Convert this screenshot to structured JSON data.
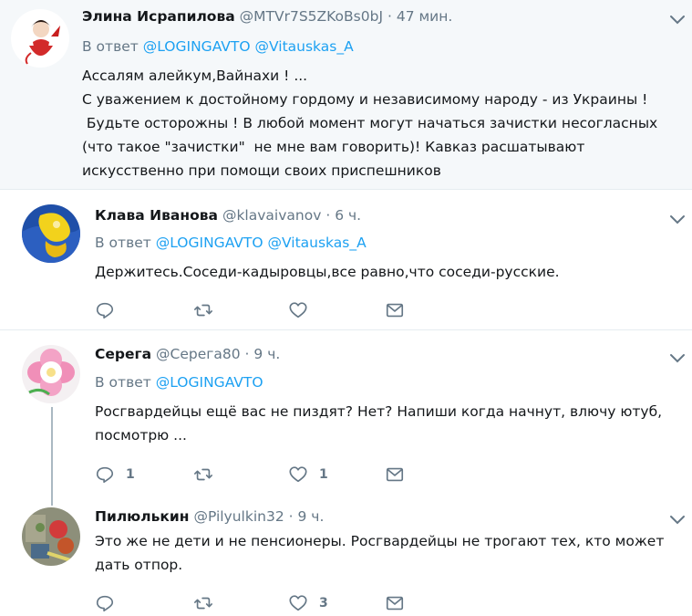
{
  "tweets": [
    {
      "name": "Элина Исрапилова",
      "handle": "@MTVr7S5ZKoBs0bJ",
      "dot": "·",
      "time": "47 мин.",
      "reply_prefix": "В ответ",
      "reply_to": [
        "@LOGINGAVTO",
        "@Vitauskas_A"
      ],
      "lines": [
        "Ассалям алейкум,Вайнахи ! ...",
        "С уважением к достойному гордому и независимому народу - из Украины !",
        " Будьте осторожны ! В любой момент могут начаться зачистки несогласных",
        "(что такое \"зачистки\"  не мне вам говорить)! Кавказ расшатывают",
        "искусственно при помощи своих приспешников"
      ]
    },
    {
      "name": "Клава Иванова",
      "handle": "@klavaivanov",
      "dot": "·",
      "time": "6 ч.",
      "reply_prefix": "В ответ",
      "reply_to": [
        "@LOGINGAVTO",
        "@Vitauskas_A"
      ],
      "lines": [
        "Держитесь.Соседи-кадыровцы,все равно,что соседи-русские."
      ],
      "counts": {
        "reply": "",
        "retweet": "",
        "like": ""
      }
    },
    {
      "name": "Серега",
      "handle": "@Серега80",
      "dot": "·",
      "time": "9 ч.",
      "reply_prefix": "В ответ",
      "reply_to": [
        "@LOGINGAVTO"
      ],
      "lines": [
        "Росгвардейцы ещё вас не пиздят? Нет? Напиши когда начнут, влючу ютуб,",
        "посмотрю ..."
      ],
      "counts": {
        "reply": "1",
        "retweet": "",
        "like": "1"
      }
    },
    {
      "name": "Пилюлькин",
      "handle": "@Pilyulkin32",
      "dot": "·",
      "time": "9 ч.",
      "lines": [
        "Это же не дети и не пенсионеры. Росгвардейцы не трогают тех, кто может",
        "дать отпор."
      ],
      "counts": {
        "reply": "",
        "retweet": "",
        "like": "3"
      }
    }
  ],
  "colors": {
    "link": "#1da1f2",
    "muted": "#657786",
    "text": "#14171a",
    "highlight_bg": "#f5f8fa"
  },
  "icons": [
    "chevron-down-icon",
    "reply-icon",
    "retweet-icon",
    "like-icon",
    "message-icon"
  ]
}
